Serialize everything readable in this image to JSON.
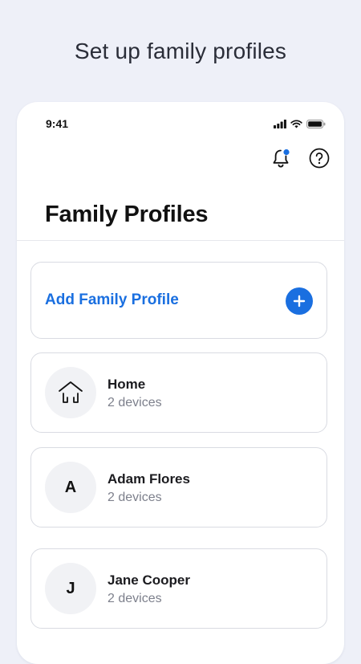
{
  "caption": "Set up family profiles",
  "status_bar": {
    "time": "9:41",
    "icons": [
      "signal-icon",
      "wifi-icon",
      "battery-icon"
    ]
  },
  "header": {
    "actions": [
      "notification-bell-icon",
      "help-icon"
    ],
    "notification_dot_color": "#1a6fe0"
  },
  "page_title": "Family Profiles",
  "add_profile": {
    "label": "Add Family Profile",
    "icon": "plus-icon"
  },
  "profiles": [
    {
      "name": "Home",
      "devices": "2 devices",
      "avatar": "house-icon",
      "initial": ""
    },
    {
      "name": "Adam Flores",
      "devices": "2 devices",
      "avatar": "initial",
      "initial": "A"
    },
    {
      "name": "Jane Cooper",
      "devices": "2 devices",
      "avatar": "initial",
      "initial": "J"
    }
  ],
  "colors": {
    "accent": "#1a6fe0",
    "background": "#eef0f8",
    "card_border": "#d9dbe2",
    "secondary_text": "#7d808c"
  }
}
